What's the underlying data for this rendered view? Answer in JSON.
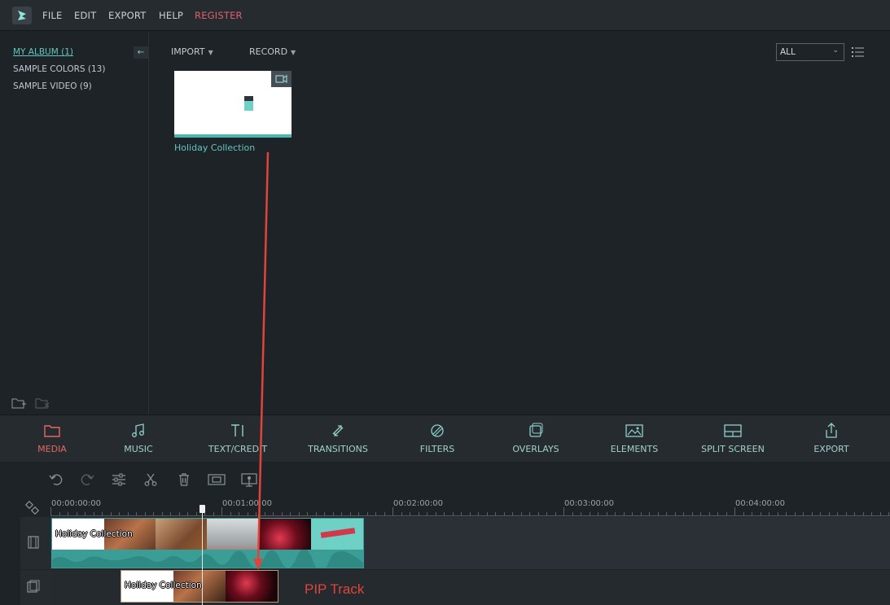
{
  "menu": {
    "items": [
      "FILE",
      "EDIT",
      "EXPORT",
      "HELP"
    ],
    "register": "REGISTER"
  },
  "library": {
    "albums": [
      {
        "label": "MY ALBUM (1)",
        "active": true
      },
      {
        "label": "SAMPLE COLORS (13)",
        "active": false
      },
      {
        "label": "SAMPLE VIDEO (9)",
        "active": false
      }
    ],
    "import_label": "IMPORT",
    "record_label": "RECORD",
    "filter_value": "ALL",
    "media_item": {
      "label": "Holiday Collection",
      "type_icon": "video-camera-icon"
    }
  },
  "categories": [
    {
      "label": "MEDIA",
      "icon": "folder-icon",
      "active": true
    },
    {
      "label": "MUSIC",
      "icon": "music-note-icon"
    },
    {
      "label": "TEXT/CREDIT",
      "icon": "text-icon"
    },
    {
      "label": "TRANSITIONS",
      "icon": "transitions-icon"
    },
    {
      "label": "FILTERS",
      "icon": "filters-icon"
    },
    {
      "label": "OVERLAYS",
      "icon": "overlays-icon"
    },
    {
      "label": "ELEMENTS",
      "icon": "image-icon"
    },
    {
      "label": "SPLIT SCREEN",
      "icon": "split-screen-icon"
    },
    {
      "label": "EXPORT",
      "icon": "share-icon"
    }
  ],
  "timeline": {
    "timecodes": [
      "00:00:00:00",
      "00:01:00:00",
      "00:02:00:00",
      "00:03:00:00",
      "00:04:00:00"
    ],
    "video_clip_title": "Holiday Collection",
    "pip_clip_title": "Holiday Collection",
    "annotation": "PIP Track"
  },
  "colors": {
    "accent": "#5fc7c0",
    "active_red": "#e4685f",
    "annotation_red": "#e0443a"
  }
}
